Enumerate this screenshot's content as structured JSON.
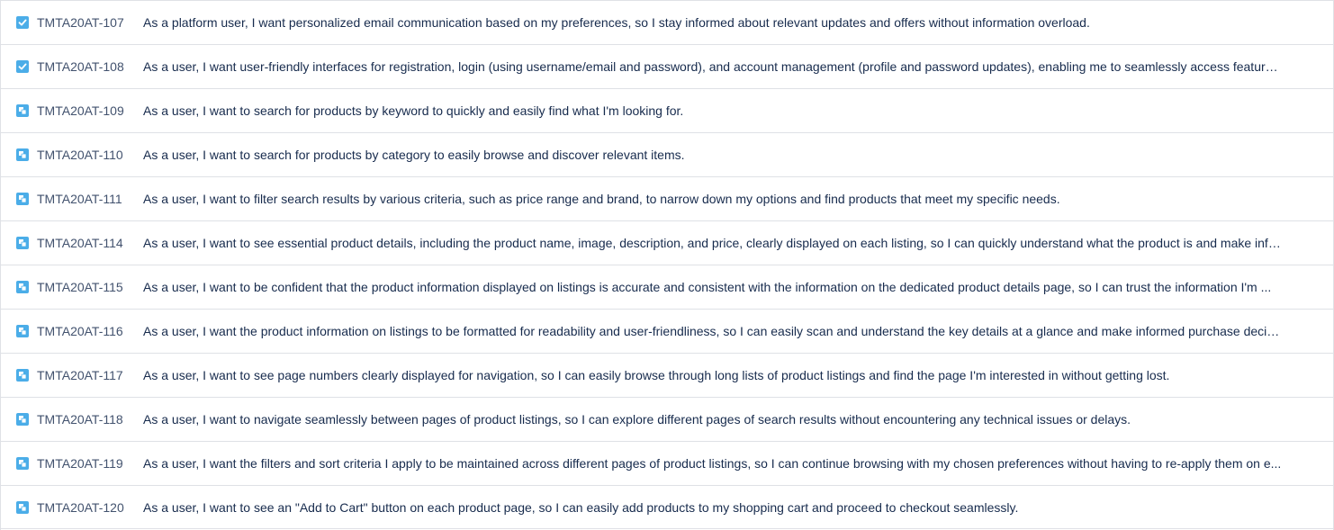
{
  "colors": {
    "icon_blue": "#4bade8",
    "text": "#172b4d",
    "key_text": "#42526e",
    "divider": "#dfe1e6"
  },
  "issues": [
    {
      "type_icon": "task-checkbox-icon",
      "key": "TMTA20AT-107",
      "summary": "As a platform user, I want personalized email communication based on my preferences, so I stay informed about relevant updates and offers without information overload."
    },
    {
      "type_icon": "task-checkbox-icon",
      "key": "TMTA20AT-108",
      "summary": "As a user, I want user-friendly interfaces for registration, login (using username/email and password), and account management (profile and password updates), enabling me to seamlessly access features ..."
    },
    {
      "type_icon": "subtask-icon",
      "key": "TMTA20AT-109",
      "summary": "As a user, I want to search for products by keyword to quickly and easily find what I'm looking for."
    },
    {
      "type_icon": "subtask-icon",
      "key": "TMTA20AT-110",
      "summary": "As a user, I want to search for products by category to easily browse and discover relevant items."
    },
    {
      "type_icon": "subtask-icon",
      "key": "TMTA20AT-111",
      "summary": "As a user, I want to filter search results by various criteria, such as price range and brand, to narrow down my options and find products that meet my specific needs."
    },
    {
      "type_icon": "subtask-icon",
      "key": "TMTA20AT-114",
      "summary": "As a user, I want to see essential product details, including the product name, image, description, and price, clearly displayed on each listing, so I can quickly understand what the product is and make infor..."
    },
    {
      "type_icon": "subtask-icon",
      "key": "TMTA20AT-115",
      "summary": "As a user, I want to be confident that the product information displayed on listings is accurate and consistent with the information on the dedicated product details page, so I can trust the information I'm ..."
    },
    {
      "type_icon": "subtask-icon",
      "key": "TMTA20AT-116",
      "summary": "As a user, I want the product information on listings to be formatted for readability and user-friendliness, so I can easily scan and understand the key details at a glance and make informed purchase decisi..."
    },
    {
      "type_icon": "subtask-icon",
      "key": "TMTA20AT-117",
      "summary": "As a user, I want to see page numbers clearly displayed for navigation, so I can easily browse through long lists of product listings and find the page I'm interested in without getting lost."
    },
    {
      "type_icon": "subtask-icon",
      "key": "TMTA20AT-118",
      "summary": "As a user, I want to navigate seamlessly between pages of product listings, so I can explore different pages of search results without encountering any technical issues or delays."
    },
    {
      "type_icon": "subtask-icon",
      "key": "TMTA20AT-119",
      "summary": "As a user, I want the filters and sort criteria I apply to be maintained across different pages of product listings, so I can continue browsing with my chosen preferences without having to re-apply them on e..."
    },
    {
      "type_icon": "subtask-icon",
      "key": "TMTA20AT-120",
      "summary": "As a user, I want to see an \"Add to Cart\" button on each product page, so I can easily add products to my shopping cart and proceed to checkout seamlessly."
    }
  ]
}
